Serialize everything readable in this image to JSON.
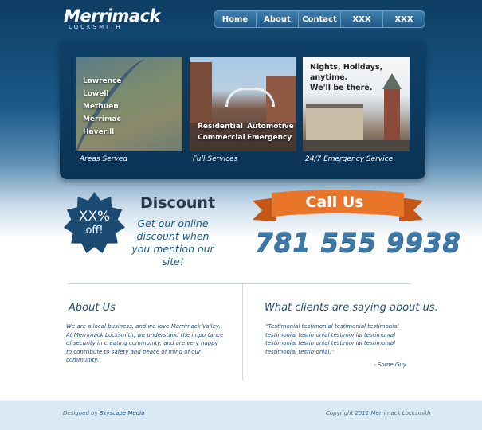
{
  "logo": {
    "name": "Merrimack",
    "sub": "LOCKSMITH"
  },
  "nav": {
    "items": [
      "Home",
      "About",
      "Contact",
      "XXX",
      "XXX"
    ]
  },
  "services": {
    "areas": {
      "towns": [
        "Lawrence",
        "Lowell",
        "Methuen",
        "Merrimac",
        "Haverill"
      ],
      "caption": "Areas Served"
    },
    "full": {
      "labels": [
        "Residential",
        "Automotive",
        "Commercial",
        "Emergency"
      ],
      "caption": "Full Services"
    },
    "emergency": {
      "line1": "Nights, Holidays, anytime.",
      "line2": "We'll be there.",
      "caption": "24/7 Emergency Service"
    }
  },
  "discount": {
    "badge_pct": "XX%",
    "badge_off": "off!",
    "title": "Discount",
    "body": "Get our online discount when you mention our site!"
  },
  "call": {
    "label": "Call Us",
    "phone": "781 555 9938"
  },
  "about": {
    "title": "About Us",
    "body": "We are a local business, and we love Merrimack Valley. At Merrimack Locksmith, we understand the importance of security in creating community, and are very happy to contribute to safety and peace of mind of our community."
  },
  "clients": {
    "title": "What clients are saying about us.",
    "quote": "“Testimonial testimonial testimonial testimonial testimonial testimonial testimonial testimonial testimonial testimonial testimonial testimonial testimonial testimonial.”",
    "author": "- Some Guy"
  },
  "footer": {
    "designed_prefix": "Designed by",
    "designer": "Skyscape Media",
    "copyright": "Copyright 2011 Merrimack Locksmith"
  },
  "colors": {
    "header_dark": "#0d3d63",
    "accent_blue": "#1d4f7a",
    "phone_blue": "#3d78a6",
    "ribbon_orange": "#e8752a",
    "badge_navy": "#1b4a73"
  }
}
